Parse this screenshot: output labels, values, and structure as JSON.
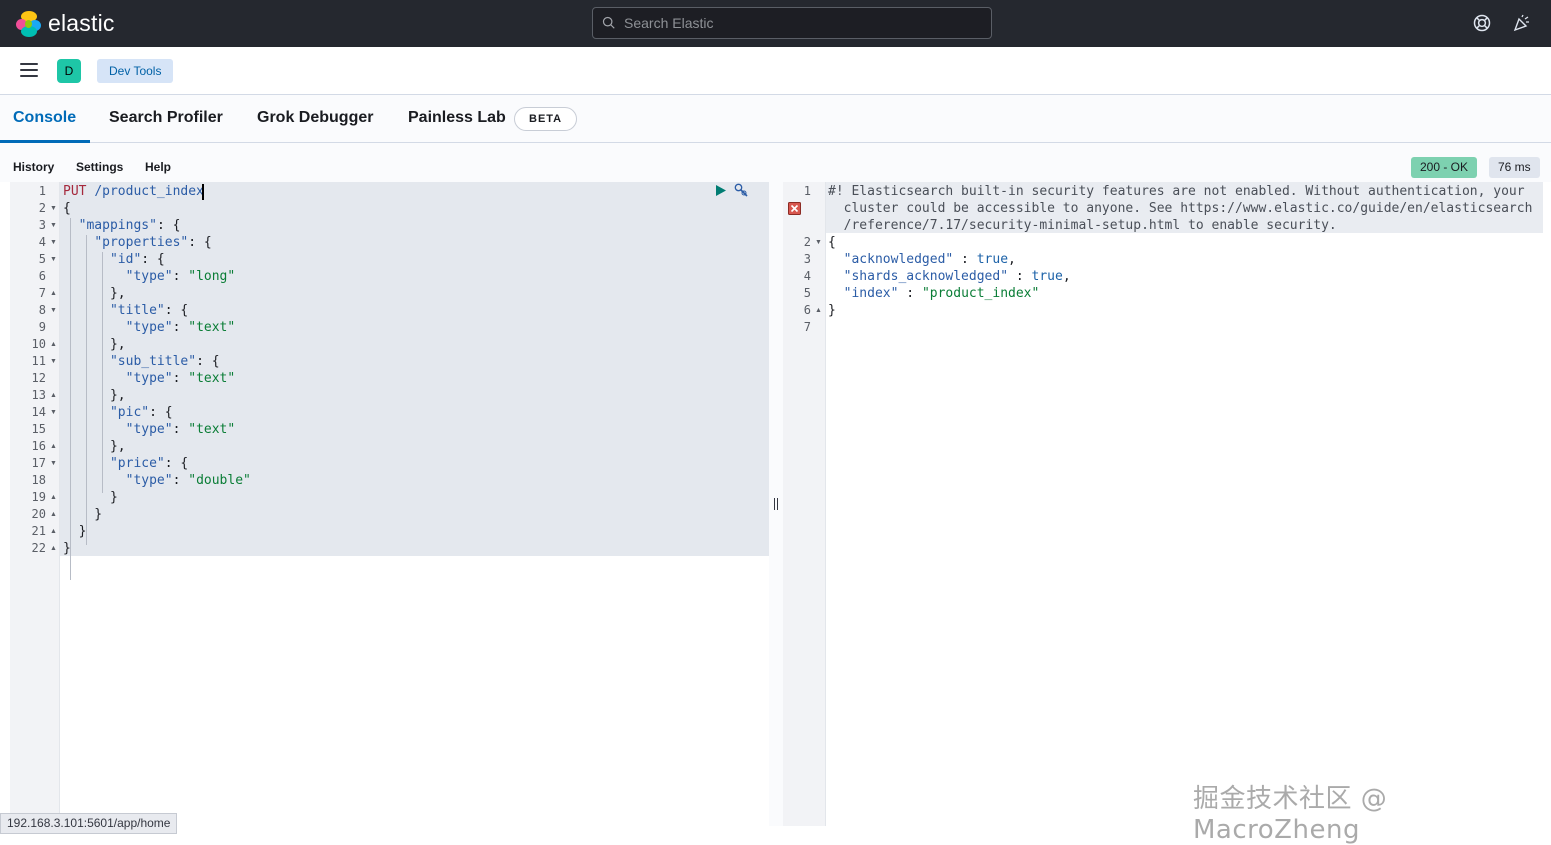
{
  "header": {
    "logo_text": "elastic",
    "search_placeholder": "Search Elastic",
    "icons": [
      "help-icon",
      "newsfeed-icon"
    ]
  },
  "breadcrumb": {
    "space_initial": "D",
    "app": "Dev Tools"
  },
  "tabs": [
    {
      "label": "Console",
      "active": true
    },
    {
      "label": "Search Profiler",
      "active": false
    },
    {
      "label": "Grok Debugger",
      "active": false
    },
    {
      "label": "Painless Lab",
      "active": false
    }
  ],
  "beta_badge": "BETA",
  "submenu": [
    "History",
    "Settings",
    "Help"
  ],
  "response_status": {
    "code": "200 - OK",
    "time": "76 ms"
  },
  "request_editor": {
    "lines": [
      "PUT /product_index",
      "{",
      "  \"mappings\": {",
      "    \"properties\": {",
      "      \"id\": {",
      "        \"type\": \"long\"",
      "      },",
      "      \"title\": {",
      "        \"type\": \"text\"",
      "      },",
      "      \"sub_title\": {",
      "        \"type\": \"text\"",
      "      },",
      "      \"pic\": {",
      "        \"type\": \"text\"",
      "      },",
      "      \"price\": {",
      "        \"type\": \"double\"",
      "      }",
      "    }",
      "  }",
      "}"
    ]
  },
  "response_editor": {
    "warning": [
      "#! Elasticsearch built-in security features are not enabled. Without authentication, your",
      "  cluster could be accessible to anyone. See https://www.elastic.co/guide/en/elasticsearch",
      "  /reference/7.17/security-minimal-setup.html to enable security."
    ],
    "lines": [
      "{",
      "  \"acknowledged\" : true,",
      "  \"shards_acknowledged\" : true,",
      "  \"index\" : \"product_index\"",
      "}",
      ""
    ]
  },
  "status_url": "192.168.3.101:5601/app/home",
  "watermark": "掘金技术社区 @ MacroZheng",
  "colors": {
    "accent": "#006bb8",
    "topbar": "#25282f",
    "status_ok": "#7dd1b0",
    "space_avatar": "#1ec6a7"
  }
}
